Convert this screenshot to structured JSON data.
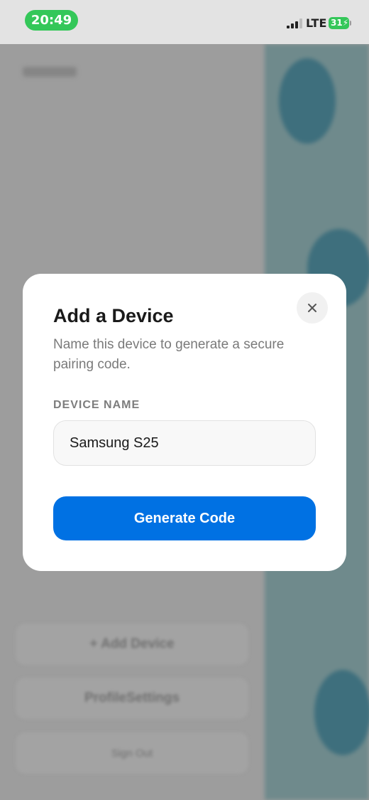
{
  "status_bar": {
    "time": "20:49",
    "network": "LTE",
    "battery": "31",
    "accent_color": "#34c759"
  },
  "modal": {
    "title": "Add a Device",
    "subtitle": "Name this device to generate a secure pairing code.",
    "field_label": "DEVICE NAME",
    "device_name_value": "Samsung S25",
    "primary_button": "Generate Code",
    "close_icon": "close-icon",
    "primary_color": "#0071e3"
  },
  "background": {
    "buttons": [
      "+ Add Device",
      "ProfileSettings",
      "Sign Out"
    ]
  }
}
